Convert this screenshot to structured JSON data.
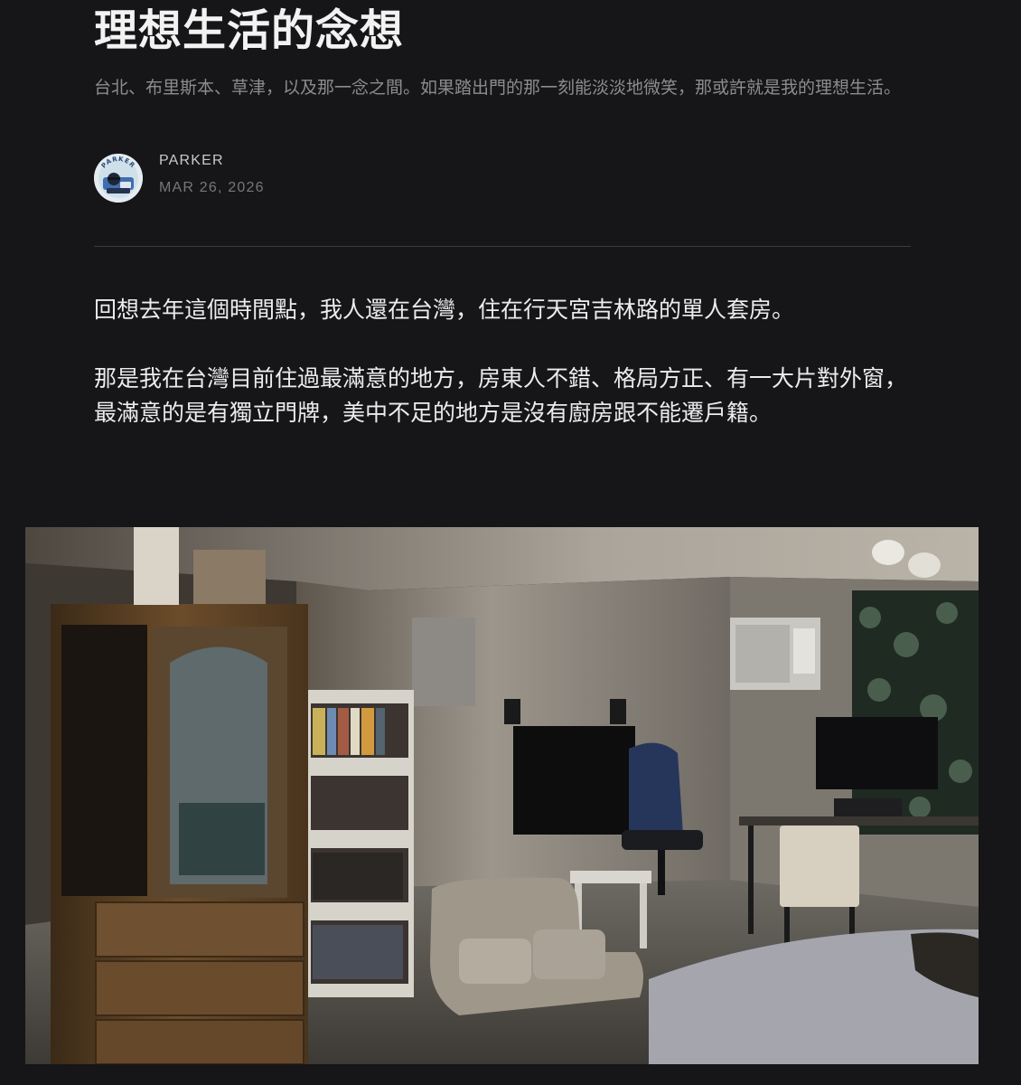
{
  "article": {
    "title": "理想生活的念想",
    "subtitle": "台北、布里斯本、草津，以及那一念之間。如果踏出門的那一刻能淡淡地微笑，那或許就是我的理想生活。",
    "author": {
      "name": "PARKER",
      "date": "MAR 26, 2026",
      "avatar_text": "PARKER"
    },
    "paragraphs": [
      "回想去年這個時間點，我人還在台灣，住在行天宮吉林路的單人套房。",
      "那是我在台灣目前住過最滿意的地方，房東人不錯、格局方正、有一大片對外窗，最滿意的是有獨立門牌，美中不足的地方是沒有廚房跟不能遷戶籍。"
    ]
  },
  "colors": {
    "background": "#161618",
    "title": "#f2f2f3",
    "subtitle": "#8c8c90",
    "body_text": "#ececee",
    "divider": "#3a3a3d"
  }
}
